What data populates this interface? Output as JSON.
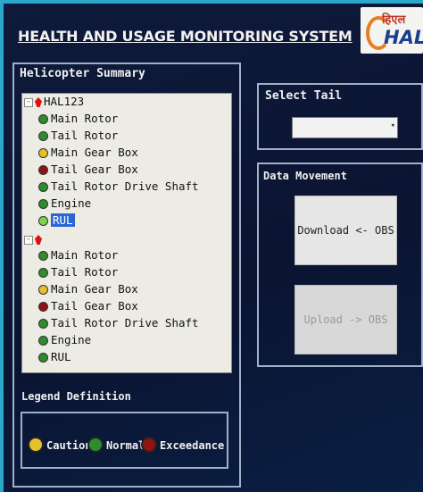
{
  "header": {
    "title": "HEALTH AND USAGE MONITORING SYSTEM",
    "logo_text": "HAL",
    "logo_hindi": "हिएल"
  },
  "summary": {
    "title": "Helicopter Summary",
    "aircraft": [
      {
        "tail": "HAL123",
        "items": [
          {
            "label": "Main Rotor",
            "status": "green"
          },
          {
            "label": "Tail Rotor",
            "status": "green"
          },
          {
            "label": "Main Gear Box",
            "status": "yellow"
          },
          {
            "label": "Tail Gear Box",
            "status": "red"
          },
          {
            "label": "Tail Rotor Drive Shaft",
            "status": "green"
          },
          {
            "label": "Engine",
            "status": "green"
          },
          {
            "label": "RUL",
            "status": "green"
          }
        ]
      },
      {
        "tail": "",
        "items": [
          {
            "label": "Main Rotor",
            "status": "green"
          },
          {
            "label": "Tail Rotor",
            "status": "green"
          },
          {
            "label": "Main Gear Box",
            "status": "yellow"
          },
          {
            "label": "Tail Gear Box",
            "status": "red"
          },
          {
            "label": "Tail Rotor Drive Shaft",
            "status": "green"
          },
          {
            "label": "Engine",
            "status": "green"
          },
          {
            "label": "RUL",
            "status": "green"
          }
        ]
      }
    ]
  },
  "legend": {
    "title": "Legend Definition",
    "caution": "Caution",
    "normal": "Normal",
    "exceedance": "Exceedance",
    "colors": {
      "caution": "#e5c029",
      "normal": "#2e8b2e",
      "exceedance": "#8e1414"
    }
  },
  "select_tail": {
    "title": "Select Tail",
    "value": ""
  },
  "data_movement": {
    "title": "Data Movement",
    "download_label": "Download <- OBS",
    "upload_label": "Upload -> OBS"
  }
}
